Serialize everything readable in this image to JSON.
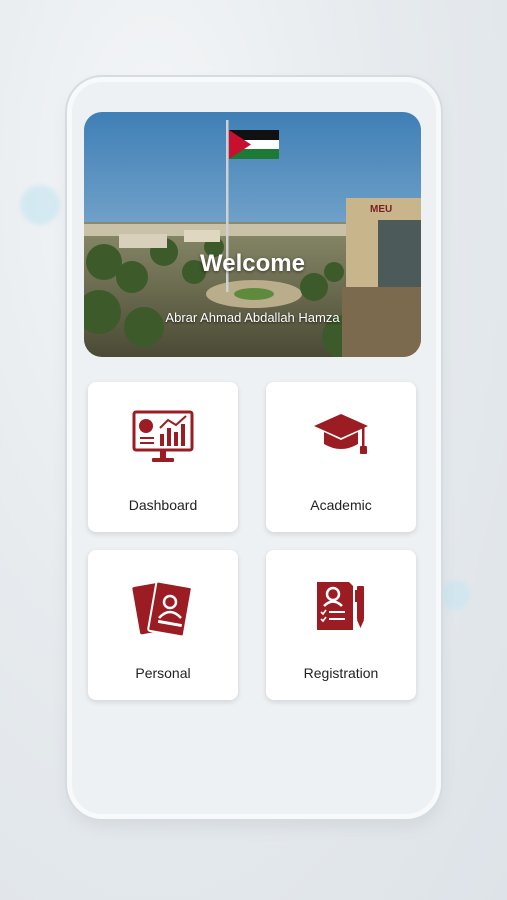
{
  "hero": {
    "welcome": "Welcome",
    "user_name": "Abrar Ahmad Abdallah Hamza",
    "building_sign": "MEU"
  },
  "menu": [
    {
      "label": "Dashboard",
      "icon": "dashboard-monitor-icon"
    },
    {
      "label": "Academic",
      "icon": "graduation-cap-icon"
    },
    {
      "label": "Personal",
      "icon": "personal-profile-icon"
    },
    {
      "label": "Registration",
      "icon": "registration-form-icon"
    }
  ],
  "colors": {
    "accent": "#9b1c23",
    "card": "#ffffff",
    "panel": "#eef1f3"
  }
}
